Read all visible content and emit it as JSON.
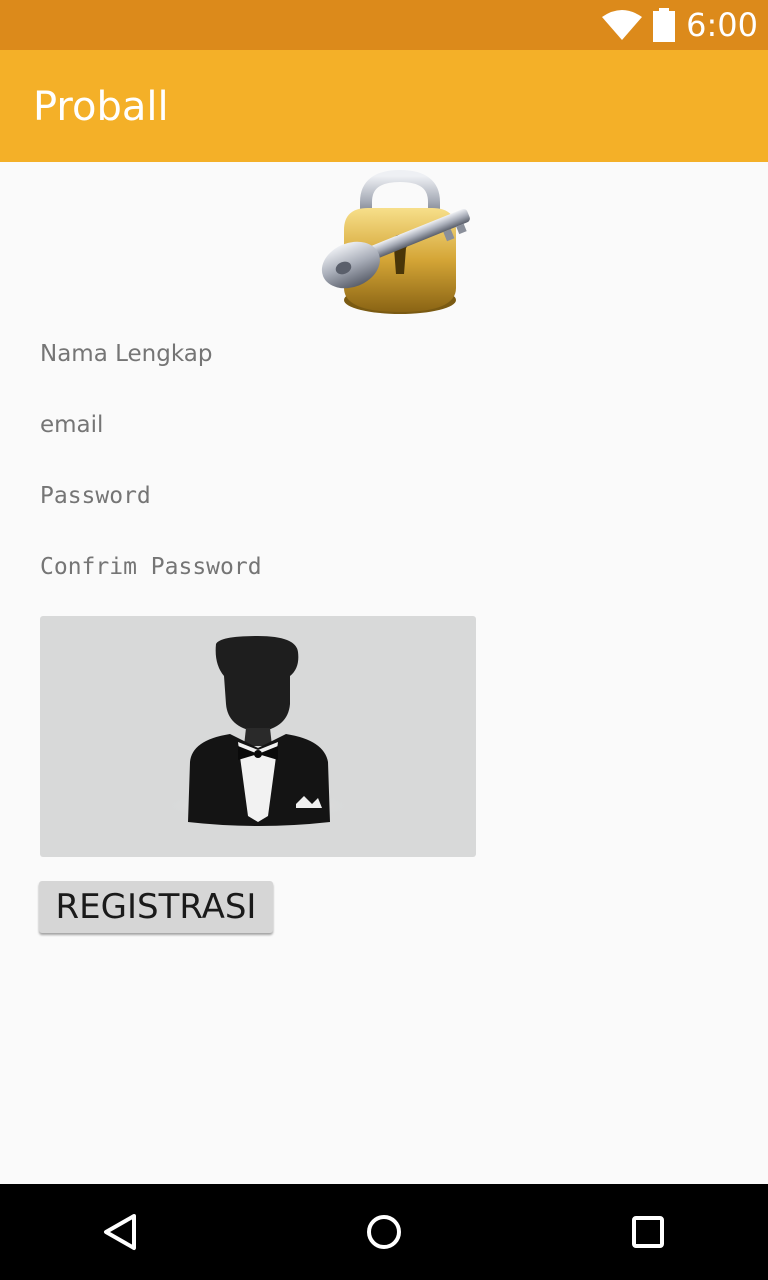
{
  "status_bar": {
    "time": "6:00"
  },
  "app_bar": {
    "title": "Proball"
  },
  "form": {
    "full_name_placeholder": "Nama Lengkap",
    "email_placeholder": "email",
    "password_placeholder": "Password",
    "confirm_password_placeholder": "Confrim Password",
    "register_label": "REGISTRASI"
  },
  "icons": {
    "logo": "lock-with-key-icon",
    "avatar": "user-silhouette-icon",
    "nav": [
      "back-icon",
      "home-icon",
      "recents-icon"
    ]
  },
  "colors": {
    "status_bar": "#dc8a1b",
    "app_bar": "#f4b028",
    "background": "#fafafa",
    "hint_text": "#757575",
    "button": "#d6d6d6",
    "avatar_bg": "#d8d9d9"
  }
}
